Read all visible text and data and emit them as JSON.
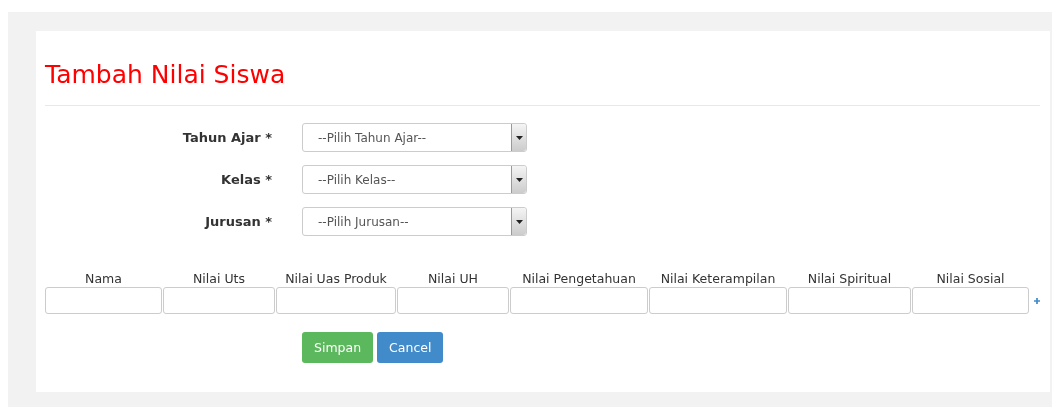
{
  "title": "Tambah Nilai Siswa",
  "fields": [
    {
      "label": "Tahun Ajar *",
      "placeholder": "--Pilih Tahun Ajar--"
    },
    {
      "label": "Kelas *",
      "placeholder": "--Pilih Kelas--"
    },
    {
      "label": "Jurusan *",
      "placeholder": "--Pilih Jurusan--"
    }
  ],
  "columns": [
    "Nama",
    "Nilai Uts",
    "Nilai Uas Produk",
    "Nilai UH",
    "Nilai Pengetahuan",
    "Nilai Keterampilan",
    "Nilai Spiritual",
    "Nilai Sosial"
  ],
  "buttons": [
    {
      "label": "Simpan",
      "kind": "primary"
    },
    {
      "label": "Cancel",
      "kind": "secondary"
    }
  ]
}
